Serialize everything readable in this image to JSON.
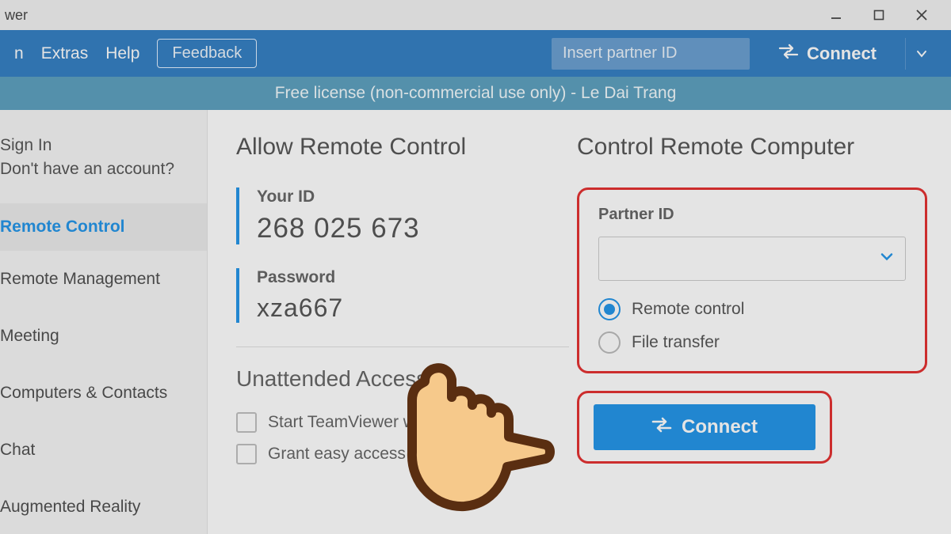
{
  "window": {
    "title_fragment": "wer"
  },
  "win_controls": {
    "min": "minimize",
    "max": "maximize",
    "close": "close"
  },
  "menubar": {
    "items": [
      "n",
      "Extras",
      "Help"
    ],
    "feedback": "Feedback",
    "partner_placeholder": "Insert partner ID",
    "connect": "Connect"
  },
  "license_text": "Free license (non-commercial use only) - Le Dai Trang",
  "sidebar": {
    "sign_in": "Sign In",
    "no_account": "Don't have an account?",
    "items": [
      "Remote Control",
      "Remote Management",
      "Meeting",
      "Computers & Contacts",
      "Chat",
      "Augmented Reality"
    ]
  },
  "allow": {
    "heading": "Allow Remote Control",
    "your_id_label": "Your ID",
    "your_id": "268 025 673",
    "password_label": "Password",
    "password": "xza667"
  },
  "unattended": {
    "heading": "Unattended Access",
    "check1": "Start TeamViewer with Windows",
    "check2": "Grant easy access"
  },
  "control": {
    "heading": "Control Remote Computer",
    "partner_label": "Partner ID",
    "partner_value": "",
    "option_remote": "Remote control",
    "option_file": "File transfer",
    "connect": "Connect"
  }
}
